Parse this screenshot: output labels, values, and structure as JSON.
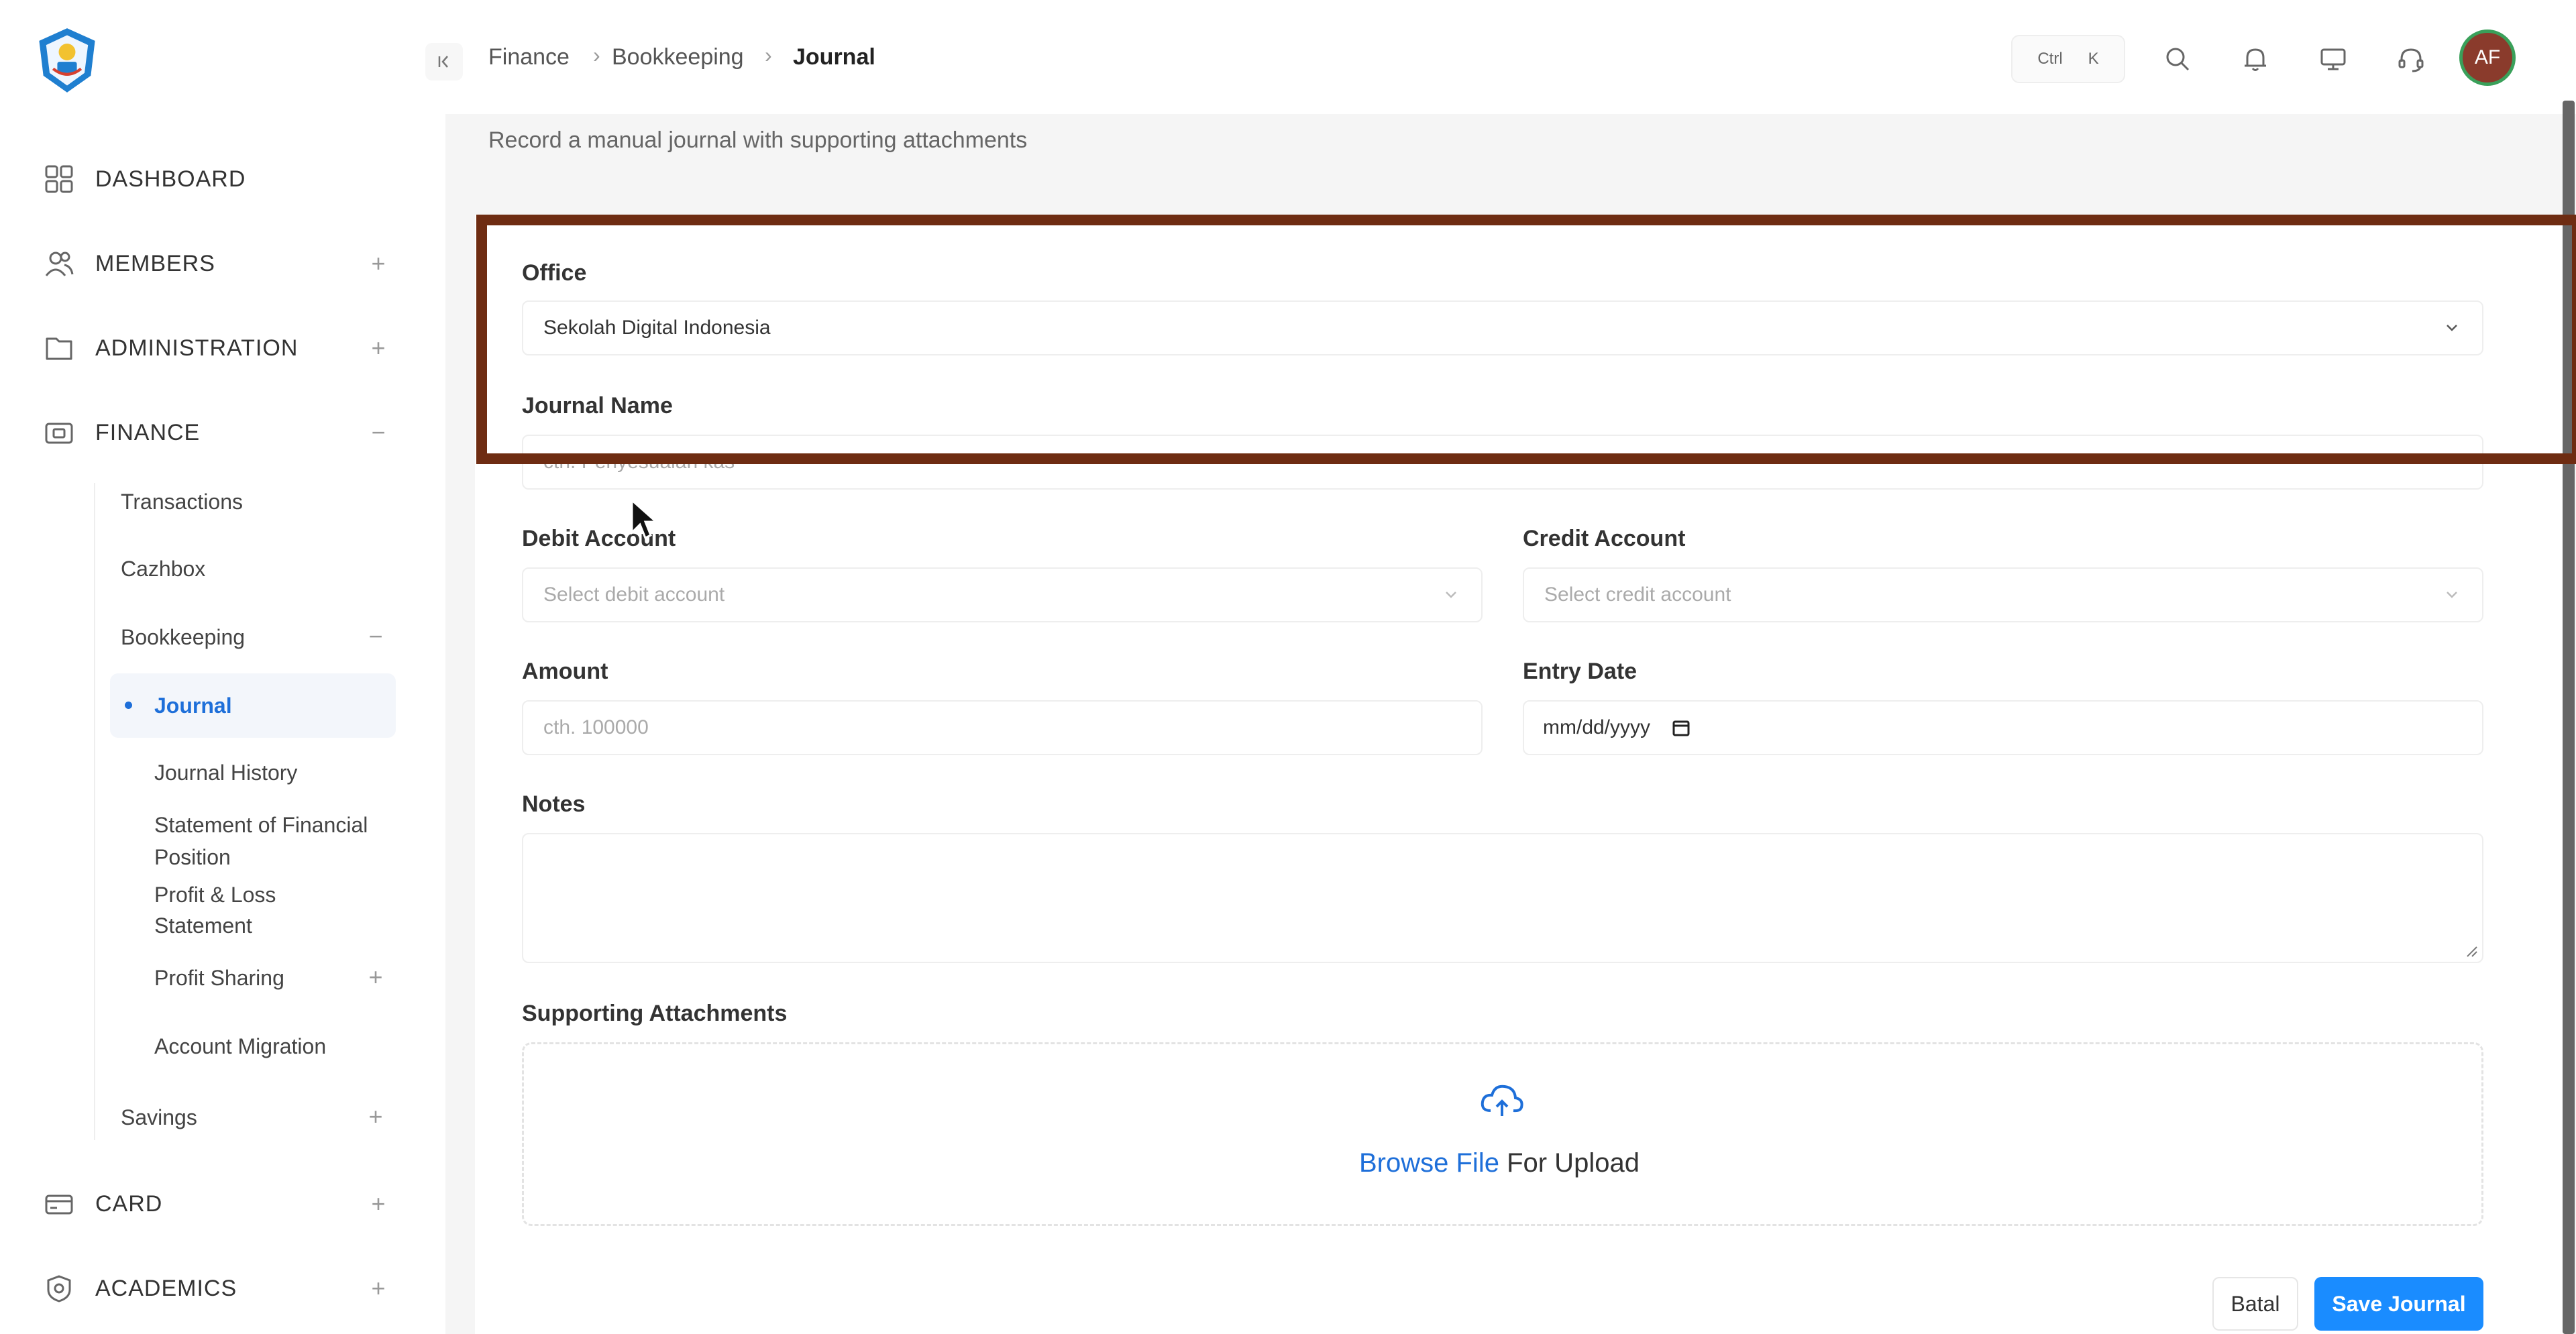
{
  "sidebar": {
    "items": [
      {
        "label": "DASHBOARD",
        "icon": "grid-icon"
      },
      {
        "label": "MEMBERS",
        "icon": "users-icon",
        "toggle": "+"
      },
      {
        "label": "ADMINISTRATION",
        "icon": "folder-icon",
        "toggle": "+"
      },
      {
        "label": "FINANCE",
        "icon": "wallet-icon",
        "toggle": "−"
      },
      {
        "label": "CARD",
        "icon": "card-icon",
        "toggle": "+"
      },
      {
        "label": "ACADEMICS",
        "icon": "academics-icon",
        "toggle": "+"
      }
    ],
    "finance_children": {
      "transactions": "Transactions",
      "cazhbox": "Cazhbox",
      "bookkeeping": "Bookkeeping",
      "bookkeeping_toggle": "−",
      "journal": "Journal",
      "journal_history": "Journal History",
      "sofp_line1": "Statement of Financial",
      "sofp_line2": "Position",
      "pl_line1": "Profit & Loss",
      "pl_line2": "Statement",
      "profit_sharing": "Profit Sharing",
      "profit_sharing_toggle": "+",
      "account_migration": "Account Migration",
      "savings": "Savings",
      "savings_toggle": "+"
    }
  },
  "header": {
    "breadcrumb": [
      "Finance",
      "Bookkeeping",
      "Journal"
    ],
    "shortcut": {
      "ctrl": "Ctrl",
      "key": "K"
    },
    "avatar_initials": "AF"
  },
  "page": {
    "subtitle": "Record a manual journal with supporting attachments"
  },
  "form": {
    "office": {
      "label": "Office",
      "value": "Sekolah Digital Indonesia"
    },
    "journal_name": {
      "label": "Journal Name",
      "placeholder": "cth. Penyesuaian kas"
    },
    "debit_account": {
      "label": "Debit Account",
      "placeholder": "Select debit account"
    },
    "credit_account": {
      "label": "Credit Account",
      "placeholder": "Select credit account"
    },
    "amount": {
      "label": "Amount",
      "placeholder": "cth. 100000"
    },
    "entry_date": {
      "label": "Entry Date",
      "placeholder": "mm/dd/yyyy"
    },
    "notes": {
      "label": "Notes"
    },
    "attachments": {
      "label": "Supporting Attachments",
      "browse": "Browse File",
      "suffix": " For Upload"
    },
    "cancel_label": "Batal",
    "save_label": "Save Journal"
  },
  "colors": {
    "accent": "#1a8cff",
    "link": "#1e6fd9",
    "highlight_border": "#6e2c12",
    "avatar_bg": "#8a3b2c",
    "avatar_ring": "#3aa05a"
  }
}
